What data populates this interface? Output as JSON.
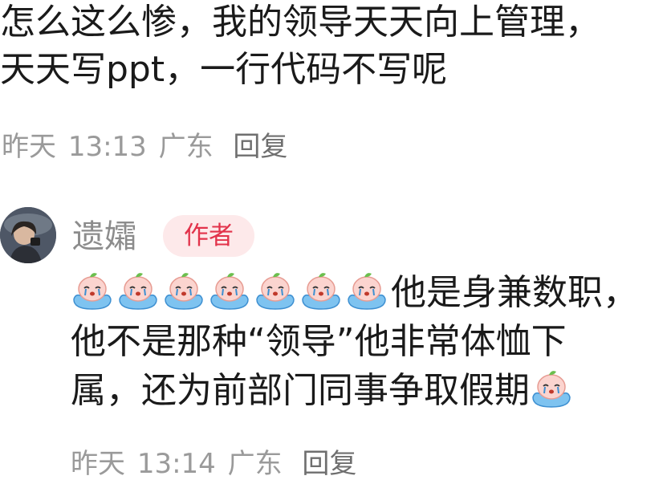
{
  "comment1": {
    "text_line1": "怎么这么惨，我的领导天天向上管理，",
    "text_line2": "天天写ppt，一行代码不写呢",
    "date": "昨天",
    "time": "13:13",
    "location": "广东",
    "reply_label": "回复"
  },
  "comment2": {
    "username": "遗孀",
    "author_badge": "作者",
    "line1_text": "他是身兼数职，",
    "line2_text": "他不是那种“领导”他非常体恤下",
    "line3_text": "属，还为前部门同事争取假期",
    "emoji_name": "crying-peach-emoji",
    "date": "昨天",
    "time": "13:14",
    "location": "广东",
    "reply_label": "回复"
  },
  "colors": {
    "meta_text": "#9a9a9a",
    "reply_text": "#6f6f6f",
    "username": "#8c8c8c",
    "badge_bg": "#fde9ea",
    "badge_text": "#e2334b"
  }
}
